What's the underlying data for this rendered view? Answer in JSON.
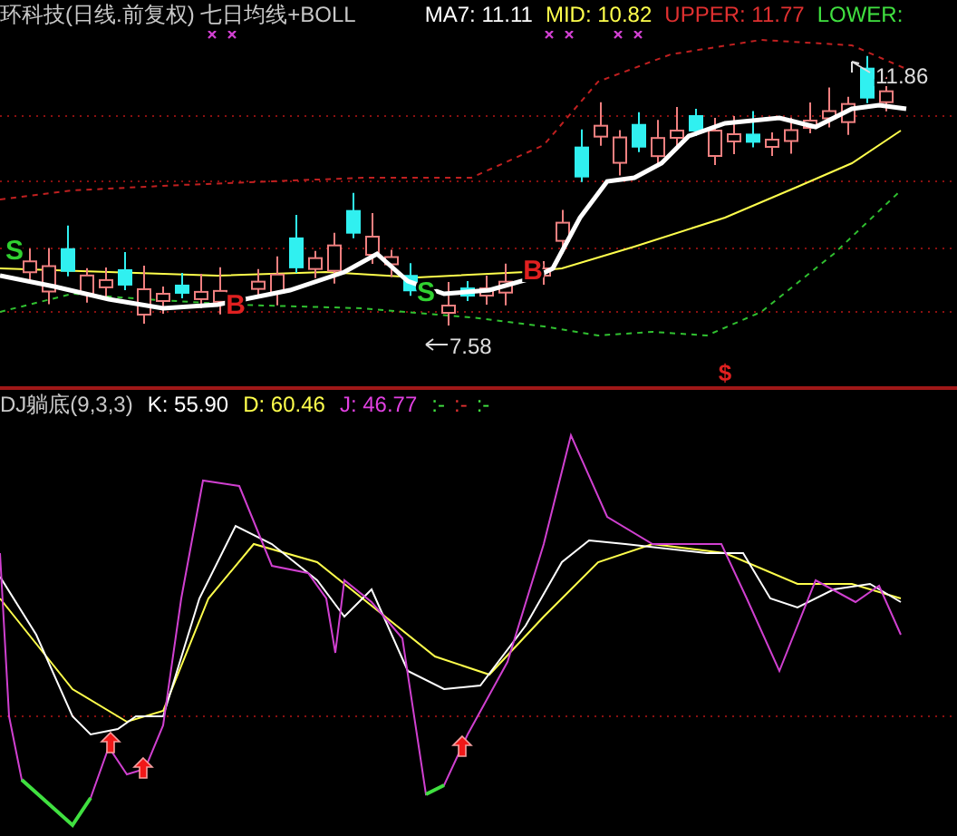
{
  "price_panel": {
    "title": "环科技(日线.前复权) 七日均线+BOLL",
    "indicators": [
      {
        "label": "MA7:",
        "value": "11.11",
        "color": "#ffffff"
      },
      {
        "label": "MID:",
        "value": "10.82",
        "color": "#ffff4c"
      },
      {
        "label": "UPPER:",
        "value": "11.77",
        "color": "#e03030"
      },
      {
        "label": "LOWER:",
        "color": "#40e040"
      }
    ],
    "signals": [
      {
        "kind": "sell",
        "text": "S"
      },
      {
        "kind": "buy",
        "text": "B"
      },
      {
        "kind": "sell",
        "text": "S"
      },
      {
        "kind": "buy",
        "text": "B"
      },
      {
        "kind": "exit",
        "text": "$"
      }
    ],
    "low_label": "7.58",
    "high_label": "11.86"
  },
  "kdj_panel": {
    "title": "DJ躺底(9,3,3)",
    "indicators": [
      {
        "label": "K:",
        "value": "55.90",
        "color": "#ffffff"
      },
      {
        "label": "D:",
        "value": "60.46",
        "color": "#ffff4c"
      },
      {
        "label": "J:",
        "value": "46.77",
        "color": "#e040e0"
      }
    ],
    "flags": [
      {
        "text": ":-",
        "color": "#40e040"
      },
      {
        "text": ":-",
        "color": "#e03030"
      },
      {
        "text": ":-",
        "color": "#40e040"
      }
    ]
  }
}
